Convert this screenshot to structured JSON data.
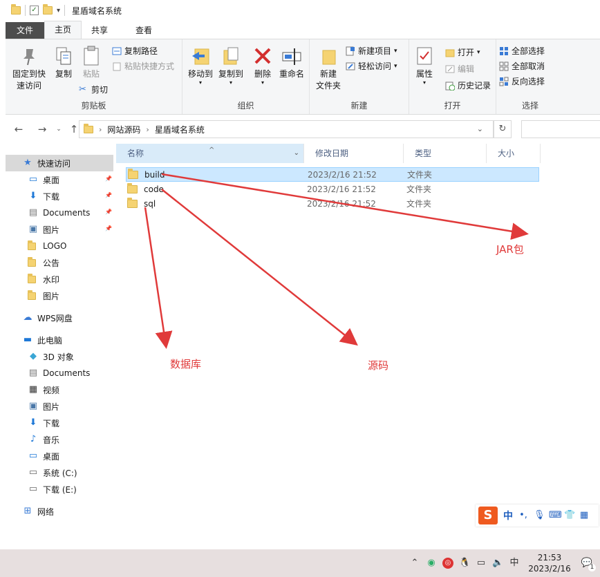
{
  "window": {
    "title": "星盾域名系统"
  },
  "ribbon": {
    "tabs": [
      "文件",
      "主页",
      "共享",
      "查看"
    ],
    "clipboard": {
      "label": "剪贴板",
      "pin": "固定到快\n速访问",
      "copy": "复制",
      "paste": "粘贴",
      "copy_path": "复制路径",
      "paste_shortcut": "粘贴快捷方式",
      "cut": "剪切"
    },
    "organize": {
      "label": "组织",
      "move_to": "移动到",
      "copy_to": "复制到",
      "delete": "删除",
      "rename": "重命名"
    },
    "new": {
      "label": "新建",
      "new_folder": "新建\n文件夹",
      "new_item": "新建项目",
      "easy_access": "轻松访问"
    },
    "open": {
      "label": "打开",
      "properties": "属性",
      "open": "打开",
      "edit": "编辑",
      "history": "历史记录"
    },
    "select": {
      "label": "选择",
      "select_all": "全部选择",
      "select_none": "全部取消",
      "invert": "反向选择"
    }
  },
  "address": {
    "crumbs": [
      "网站源码",
      "星盾域名系统"
    ]
  },
  "sidebar": {
    "items": [
      {
        "label": "快速访问",
        "icon": "star-icon",
        "selected": true,
        "pinned": false,
        "indent": 0
      },
      {
        "label": "桌面",
        "icon": "desktop-icon",
        "pinned": true,
        "indent": 1
      },
      {
        "label": "下载",
        "icon": "download-icon",
        "pinned": true,
        "indent": 1
      },
      {
        "label": "Documents",
        "icon": "document-icon",
        "pinned": true,
        "indent": 1
      },
      {
        "label": "图片",
        "icon": "picture-icon",
        "pinned": true,
        "indent": 1
      },
      {
        "label": "LOGO",
        "icon": "folder-icon",
        "pinned": false,
        "indent": 1
      },
      {
        "label": "公告",
        "icon": "folder-icon",
        "pinned": false,
        "indent": 1
      },
      {
        "label": "水印",
        "icon": "folder-icon",
        "pinned": false,
        "indent": 1
      },
      {
        "label": "图片",
        "icon": "folder-icon",
        "pinned": false,
        "indent": 1
      },
      {
        "label": "WPS网盘",
        "icon": "cloud-icon",
        "pinned": false,
        "indent": 0
      },
      {
        "label": "此电脑",
        "icon": "computer-icon",
        "pinned": false,
        "indent": 0
      },
      {
        "label": "3D 对象",
        "icon": "cube-icon",
        "pinned": false,
        "indent": 1
      },
      {
        "label": "Documents",
        "icon": "document-icon",
        "pinned": false,
        "indent": 1
      },
      {
        "label": "视频",
        "icon": "video-icon",
        "pinned": false,
        "indent": 1
      },
      {
        "label": "图片",
        "icon": "picture-icon",
        "pinned": false,
        "indent": 1
      },
      {
        "label": "下载",
        "icon": "download-icon",
        "pinned": false,
        "indent": 1
      },
      {
        "label": "音乐",
        "icon": "music-icon",
        "pinned": false,
        "indent": 1
      },
      {
        "label": "桌面",
        "icon": "desktop-icon",
        "pinned": false,
        "indent": 1
      },
      {
        "label": "系统 (C:)",
        "icon": "drive-icon",
        "pinned": false,
        "indent": 1
      },
      {
        "label": "下载 (E:)",
        "icon": "drive-icon",
        "pinned": false,
        "indent": 1
      },
      {
        "label": "网络",
        "icon": "network-icon",
        "pinned": false,
        "indent": 0
      }
    ]
  },
  "columns": {
    "name": "名称",
    "date": "修改日期",
    "type": "类型",
    "size": "大小"
  },
  "files": [
    {
      "name": "build",
      "date": "2023/2/16 21:52",
      "type": "文件夹",
      "selected": true
    },
    {
      "name": "code",
      "date": "2023/2/16 21:52",
      "type": "文件夹",
      "selected": false
    },
    {
      "name": "sql",
      "date": "2023/2/16 21:52",
      "type": "文件夹",
      "selected": false
    }
  ],
  "annotations": {
    "jar": "JAR包",
    "db": "数据库",
    "source": "源码",
    "color": "#e03a3a"
  },
  "ime": {
    "logo": "S",
    "mode": "中"
  },
  "taskbar": {
    "time": "21:53",
    "date": "2023/2/16",
    "tray_lang": "中",
    "notifications": "1"
  }
}
